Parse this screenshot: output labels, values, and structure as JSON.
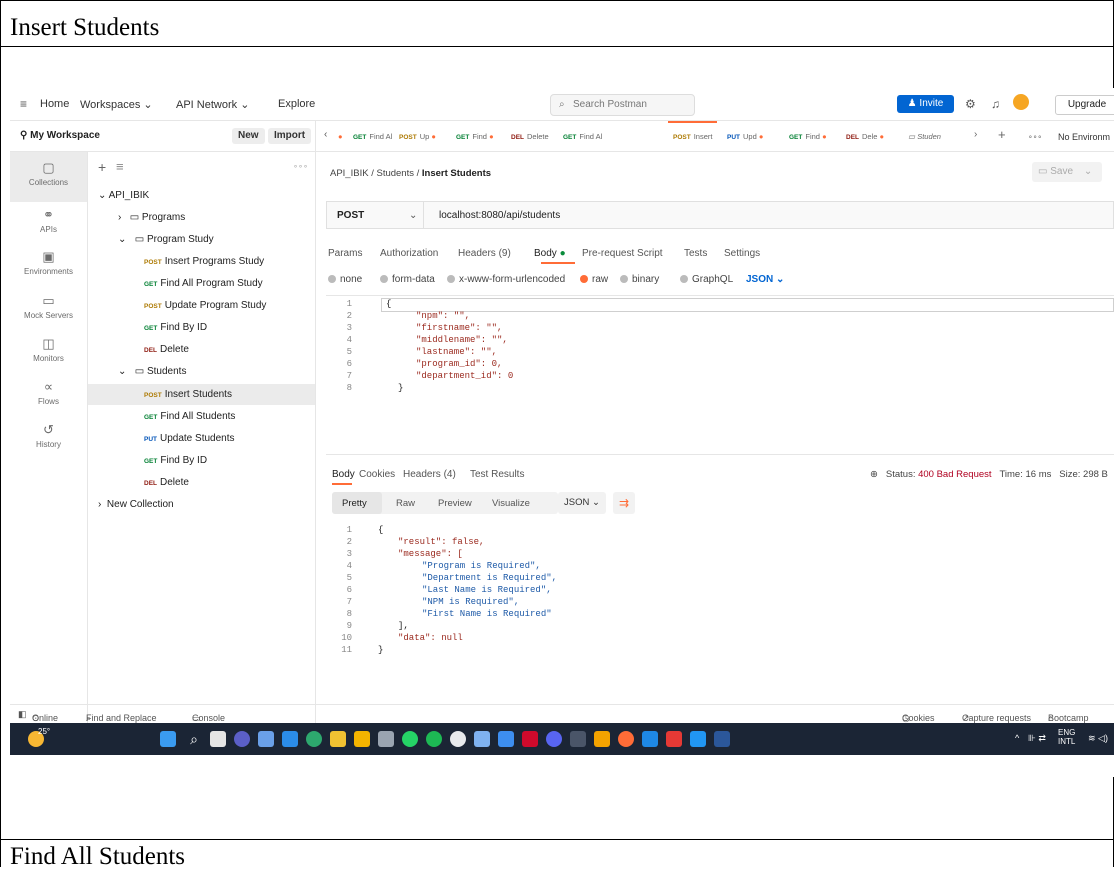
{
  "document": {
    "heading": "Insert Students",
    "footer_heading": "Find All Students"
  },
  "topbar": {
    "menu": [
      "Home",
      "Workspaces",
      "API Network",
      "Explore"
    ],
    "search_placeholder": "Search Postman",
    "invite_label": "Invite",
    "upgrade_label": "Upgrade"
  },
  "workspace": {
    "name": "My Workspace",
    "new_label": "New",
    "import_label": "Import"
  },
  "rail": [
    {
      "icon": "collections-icon",
      "label": "Collections"
    },
    {
      "icon": "apis-icon",
      "label": "APIs"
    },
    {
      "icon": "environments-icon",
      "label": "Environments"
    },
    {
      "icon": "mock-servers-icon",
      "label": "Mock Servers"
    },
    {
      "icon": "monitors-icon",
      "label": "Monitors"
    },
    {
      "icon": "flows-icon",
      "label": "Flows"
    },
    {
      "icon": "history-icon",
      "label": "History"
    }
  ],
  "tree": {
    "collection": "API_IBIK",
    "folder_programs": "Programs",
    "folder_program_study": "Program Study",
    "program_study_items": [
      {
        "method": "POST",
        "label": "Insert Programs Study"
      },
      {
        "method": "GET",
        "label": "Find All Program Study"
      },
      {
        "method": "POST",
        "label": "Update Program Study"
      },
      {
        "method": "GET",
        "label": "Find By ID"
      },
      {
        "method": "DEL",
        "label": "Delete"
      }
    ],
    "folder_students": "Students",
    "students_items": [
      {
        "method": "POST",
        "label": "Insert Students"
      },
      {
        "method": "GET",
        "label": "Find All Students"
      },
      {
        "method": "PUT",
        "label": "Update Students"
      },
      {
        "method": "GET",
        "label": "Find By ID"
      },
      {
        "method": "DEL",
        "label": "Delete"
      }
    ],
    "new_collection": "New Collection"
  },
  "tabs": [
    {
      "method": "GET",
      "label": "Find Al"
    },
    {
      "method": "POST",
      "label": "Up"
    },
    {
      "method": "GET",
      "label": "Find"
    },
    {
      "method": "DEL",
      "label": "Delete"
    },
    {
      "method": "GET",
      "label": "Find Al"
    },
    {
      "method": "POST",
      "label": "Insert"
    },
    {
      "method": "PUT",
      "label": "Upd"
    },
    {
      "method": "GET",
      "label": "Find"
    },
    {
      "method": "DEL",
      "label": "Dele"
    },
    {
      "method": "",
      "label": "Studen"
    }
  ],
  "env_label": "No Environm",
  "breadcrumb": {
    "collection": "API_IBIK",
    "folder": "Students",
    "request": "Insert Students"
  },
  "save_label": "Save",
  "request": {
    "method": "POST",
    "url": "localhost:8080/api/students",
    "tabs": [
      "Params",
      "Authorization",
      "Headers (9)",
      "Body",
      "Pre-request Script",
      "Tests",
      "Settings"
    ],
    "body_modes": [
      "none",
      "form-data",
      "x-www-form-urlencoded",
      "raw",
      "binary",
      "GraphQL"
    ],
    "body_format": "JSON",
    "body_lines": [
      "{",
      "\"npm\": \"\",",
      "\"firstname\": \"\",",
      "\"middlename\": \"\",",
      "\"lastname\": \"\",",
      "\"program_id\": 0,",
      "\"department_id\": 0",
      "}"
    ]
  },
  "response": {
    "tabs": [
      "Body",
      "Cookies",
      "Headers (4)",
      "Test Results"
    ],
    "status_label": "Status:",
    "status_value": "400 Bad Request",
    "time": "Time: 16 ms",
    "size": "Size: 298 B",
    "formats": [
      "Pretty",
      "Raw",
      "Preview",
      "Visualize"
    ],
    "format_select": "JSON",
    "lines": [
      "{",
      "\"result\": false,",
      "\"message\": [",
      "\"Program is Required\",",
      "\"Department is Required\",",
      "\"Last Name is Required\",",
      "\"NPM is Required\",",
      "\"First Name is Required\"",
      "],",
      "\"data\": null",
      "}"
    ]
  },
  "statusbar": {
    "online": "Online",
    "find_replace": "Find and Replace",
    "console": "Console",
    "cookies": "Cookies",
    "capture": "Capture requests",
    "bootcamp": "Bootcamp"
  },
  "taskbar": {
    "temperature": "25°",
    "lang": "ENG",
    "region": "INTL"
  }
}
